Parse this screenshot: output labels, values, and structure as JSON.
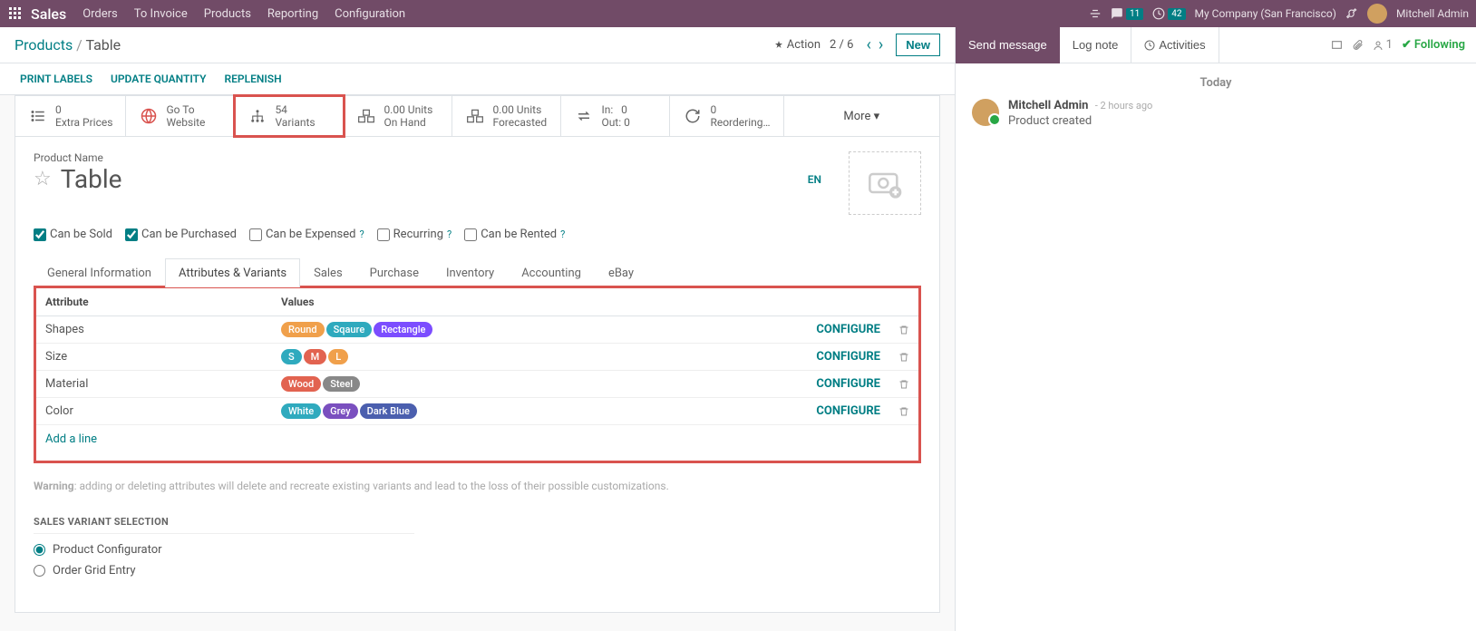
{
  "topbar": {
    "app": "Sales",
    "menu": [
      "Orders",
      "To Invoice",
      "Products",
      "Reporting",
      "Configuration"
    ],
    "chat_count": "11",
    "activity_count": "42",
    "company": "My Company (San Francisco)",
    "user": "Mitchell Admin"
  },
  "breadcrumb": {
    "parent": "Products",
    "current": "Table",
    "action": "Action",
    "pager": "2 / 6",
    "new": "New"
  },
  "actions": {
    "print": "PRINT LABELS",
    "update": "UPDATE QUANTITY",
    "replenish": "REPLENISH"
  },
  "stats": [
    {
      "line1": "0",
      "line2": "Extra Prices"
    },
    {
      "line1": "Go To",
      "line2": "Website"
    },
    {
      "line1": "54",
      "line2": "Variants"
    },
    {
      "line1": "0.00 Units",
      "line2": "On Hand"
    },
    {
      "line1": "0.00 Units",
      "line2": "Forecasted"
    },
    {
      "line1a": "In:",
      "line1b": "0",
      "line2a": "Out:",
      "line2b": "0"
    },
    {
      "line1": "0",
      "line2": "Reordering…"
    },
    {
      "line1": "More ▾"
    }
  ],
  "product": {
    "label": "Product Name",
    "name": "Table",
    "lang": "EN",
    "checks": {
      "sold": "Can be Sold",
      "purchased": "Can be Purchased",
      "expensed": "Can be Expensed",
      "recurring": "Recurring",
      "rented": "Can be Rented"
    }
  },
  "tabs": [
    "General Information",
    "Attributes & Variants",
    "Sales",
    "Purchase",
    "Inventory",
    "Accounting",
    "eBay"
  ],
  "table": {
    "col_attr": "Attribute",
    "col_vals": "Values",
    "configure": "CONFIGURE",
    "addline": "Add a line",
    "rows": [
      {
        "attr": "Shapes",
        "tags": [
          {
            "t": "Round",
            "c": "#F0A04B"
          },
          {
            "t": "Sqaure",
            "c": "#2FAABE"
          },
          {
            "t": "Rectangle",
            "c": "#7C4DFF"
          }
        ]
      },
      {
        "attr": "Size",
        "tags": [
          {
            "t": "S",
            "c": "#2FAABE"
          },
          {
            "t": "M",
            "c": "#E26350"
          },
          {
            "t": "L",
            "c": "#F0A04B"
          }
        ]
      },
      {
        "attr": "Material",
        "tags": [
          {
            "t": "Wood",
            "c": "#E26350"
          },
          {
            "t": "Steel",
            "c": "#888888"
          }
        ]
      },
      {
        "attr": "Color",
        "tags": [
          {
            "t": "White",
            "c": "#2FAABE"
          },
          {
            "t": "Grey",
            "c": "#7A4FBF"
          },
          {
            "t": "Dark Blue",
            "c": "#4B5FAE"
          }
        ]
      }
    ]
  },
  "warning_label": "Warning",
  "warning_text": ": adding or deleting attributes will delete and recreate existing variants and lead to the loss of their possible customizations.",
  "variant_section": "SALES VARIANT SELECTION",
  "radios": {
    "configurator": "Product Configurator",
    "grid": "Order Grid Entry"
  },
  "chat": {
    "send": "Send message",
    "log": "Log note",
    "activities": "Activities",
    "followers": "1",
    "following": "Following",
    "today": "Today",
    "msg_user": "Mitchell Admin",
    "msg_time": "- 2 hours ago",
    "msg_body": "Product created"
  }
}
